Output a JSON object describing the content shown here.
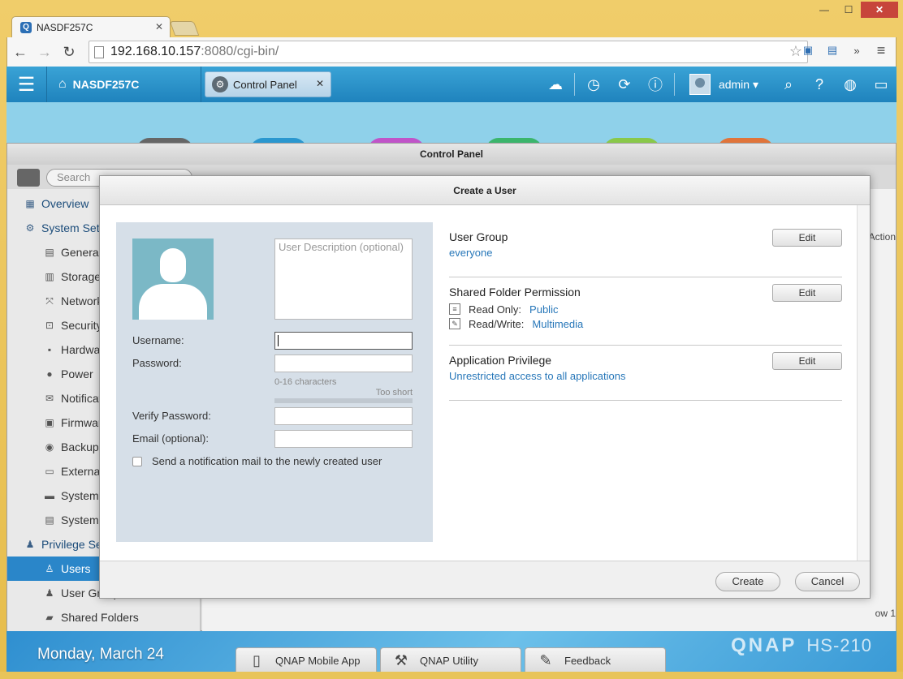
{
  "browser": {
    "tab_title": "NASDF257C",
    "favicon_letter": "Q",
    "url_host": "192.168.10.157",
    "url_path": ":8080/cgi-bin/"
  },
  "qnap": {
    "home_label": "NASDF257C",
    "open_tab": "Control Panel",
    "user": "admin"
  },
  "control_panel": {
    "title": "Control Panel",
    "search_placeholder": "Search",
    "column_action": "Action",
    "footer_text": "ow 1",
    "sidebar": [
      {
        "label": "Overview",
        "level": "head",
        "icon": "grid-icon"
      },
      {
        "label": "System Settings",
        "level": "head",
        "icon": "gear-icon"
      },
      {
        "label": "General Settings",
        "level": "sub",
        "icon": "general-icon"
      },
      {
        "label": "Storage Manager",
        "level": "sub",
        "icon": "storage-icon"
      },
      {
        "label": "Network",
        "level": "sub",
        "icon": "network-icon"
      },
      {
        "label": "Security",
        "level": "sub",
        "icon": "lock-icon"
      },
      {
        "label": "Hardware",
        "level": "sub",
        "icon": "hardware-icon"
      },
      {
        "label": "Power",
        "level": "sub",
        "icon": "power-icon"
      },
      {
        "label": "Notification",
        "level": "sub",
        "icon": "notification-icon"
      },
      {
        "label": "Firmware Update",
        "level": "sub",
        "icon": "firmware-icon"
      },
      {
        "label": "Backup / Restore",
        "level": "sub",
        "icon": "backup-icon"
      },
      {
        "label": "External Device",
        "level": "sub",
        "icon": "external-device-icon"
      },
      {
        "label": "System Status",
        "level": "sub",
        "icon": "monitor-icon"
      },
      {
        "label": "System Logs",
        "level": "sub",
        "icon": "logs-icon"
      },
      {
        "label": "Privilege Settings",
        "level": "head",
        "icon": "person-icon"
      },
      {
        "label": "Users",
        "level": "sub",
        "icon": "user-icon",
        "active": true
      },
      {
        "label": "User Groups",
        "level": "sub",
        "icon": "user-groups-icon"
      },
      {
        "label": "Shared Folders",
        "level": "sub",
        "icon": "shared-folder-icon"
      }
    ]
  },
  "modal": {
    "title": "Create a User",
    "description_placeholder": "User Description (optional)",
    "username_label": "Username:",
    "password_label": "Password:",
    "password_hint": "0-16 characters",
    "password_strength": "Too short",
    "verify_label": "Verify Password:",
    "email_label": "Email (optional):",
    "notify_label": "Send a notification mail to the newly created user",
    "user_group_title": "User Group",
    "user_group_value": "everyone",
    "edit_label": "Edit",
    "shared_folder_title": "Shared Folder Permission",
    "read_only_label": "Read Only:",
    "read_only_value": "Public",
    "read_write_label": "Read/Write:",
    "read_write_value": "Multimedia",
    "app_privilege_title": "Application Privilege",
    "app_privilege_value": "Unrestricted access to all applications",
    "create_label": "Create",
    "cancel_label": "Cancel"
  },
  "taskbar": {
    "date": "Monday, March 24",
    "buttons": [
      "QNAP Mobile App",
      "QNAP Utility",
      "Feedback"
    ],
    "brand": "QNAP",
    "model": "HS-210"
  }
}
